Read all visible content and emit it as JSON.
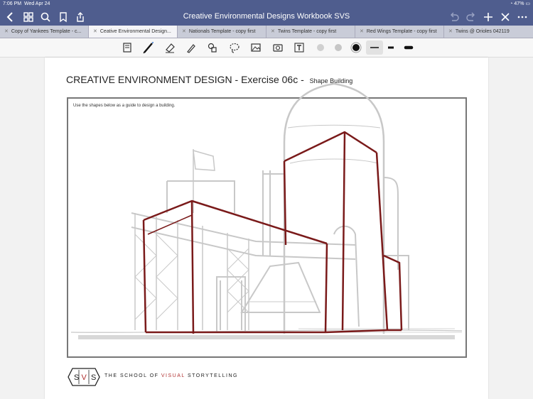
{
  "status": {
    "time": "7:06 PM",
    "date": "Wed Apr 24",
    "battery": "47%"
  },
  "titlebar": {
    "title": "Creative Environmental Designs Workbook SVS"
  },
  "tabs": [
    {
      "label": "Copy of Yankees Template - c..."
    },
    {
      "label": "Ceative Environmental Design..."
    },
    {
      "label": "Nationals Template - copy first"
    },
    {
      "label": "Twins Template - copy first"
    },
    {
      "label": "Red Wings Template - copy first"
    },
    {
      "label": "Twins @ Orioles 042119"
    }
  ],
  "document": {
    "title": "CREATIVE ENVIRONMENT DESIGN - Exercise 06c -",
    "subtitle": "Shape Building",
    "instruction": "Use the shapes below as a guide to design a building.",
    "logo_letters": [
      "S",
      "V",
      "S"
    ],
    "tagline_pre": "THE SCHOOL OF ",
    "tagline_accent": "VISUAL",
    "tagline_post": " STORYTELLING"
  },
  "colors": {
    "header": "#4f5d8e",
    "ink": "#7a1a1a",
    "accent": "#b03030"
  }
}
